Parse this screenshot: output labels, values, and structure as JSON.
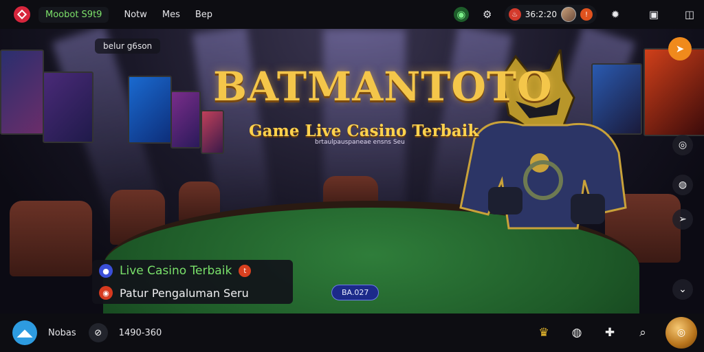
{
  "topbar": {
    "brand_chip": "Moobot S9t9",
    "nav": [
      "Notw",
      "Mes",
      "Bep"
    ],
    "balance": "36:2:20",
    "icons": [
      "shield-icon",
      "settings-icon",
      "flame-icon",
      "gear-icon",
      "bag-icon",
      "panel-icon"
    ]
  },
  "hero": {
    "label": "belur g6son",
    "title": "BATMANTOTO",
    "subtitle": "Game Live Casino Terbaik",
    "small_text": "brtaulpauspaneae ensns Seu",
    "promo": {
      "line1": "Live Casino Terbaik",
      "line2": "Patur Pengaluman Seru"
    },
    "chip_label": "BA.027"
  },
  "bottombar": {
    "text1": "Nobas",
    "text2": "1490-360"
  }
}
